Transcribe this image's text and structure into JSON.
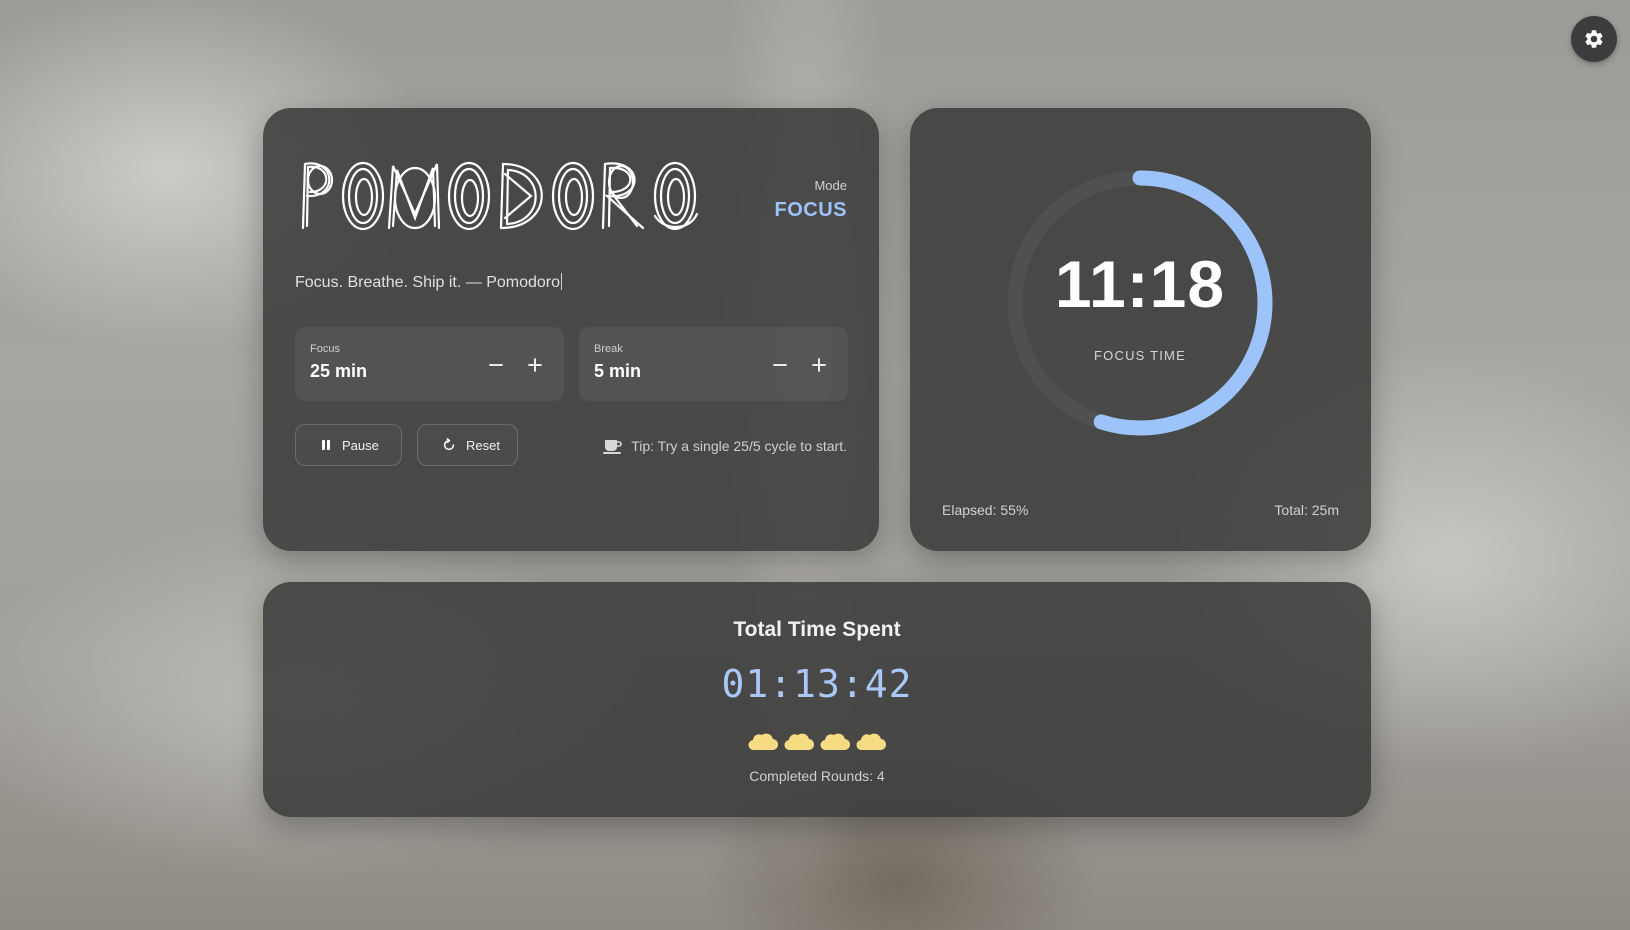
{
  "app": {
    "logo_text": "POMODORO",
    "settings_icon": "gear-icon"
  },
  "mode": {
    "label": "Mode",
    "value": "FOCUS"
  },
  "quote": "Focus. Breathe. Ship it. — Pomodoro",
  "steppers": {
    "focus": {
      "label": "Focus",
      "value": "25 min"
    },
    "break": {
      "label": "Break",
      "value": "5 min"
    }
  },
  "actions": {
    "pause_label": "Pause",
    "reset_label": "Reset"
  },
  "tip": "Tip: Try a single 25/5 cycle to start.",
  "timer": {
    "time": "11:18",
    "label": "FOCUS TIME",
    "progress": 0.55,
    "elapsed": "Elapsed: 55%",
    "total": "Total: 25m"
  },
  "summary": {
    "title": "Total Time Spent",
    "time": "01:13:42",
    "clouds_count": 4,
    "rounds": "Completed Rounds: 4"
  },
  "colors": {
    "accent": "#9cc3fa",
    "ring_track": "#505050",
    "cloud": "#f5dc82"
  }
}
